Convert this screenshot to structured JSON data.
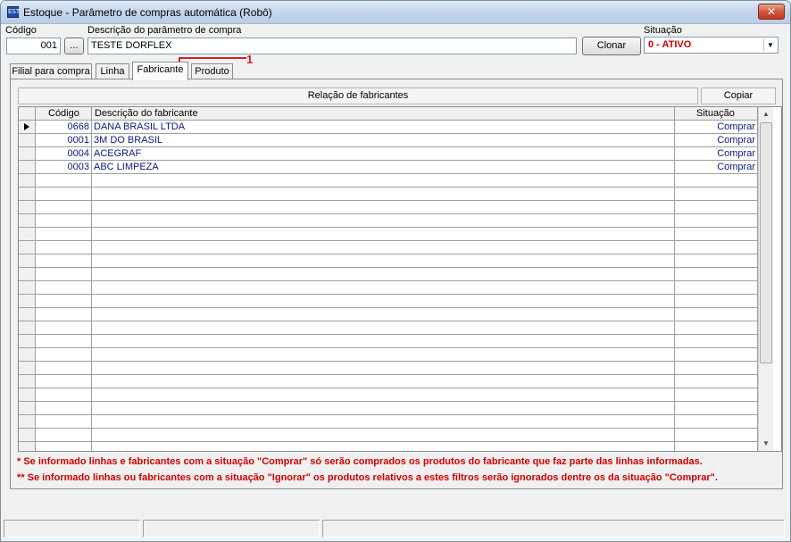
{
  "window": {
    "title": "Estoque - Parâmetro de compras automática (Robô)",
    "icon_text": "EST",
    "close_glyph": "✕"
  },
  "form": {
    "codigo_label": "Código",
    "codigo_value": "001",
    "lookup_button": "...",
    "descricao_label": "Descrição do parâmetro de compra",
    "descricao_value": "TESTE DORFLEX",
    "clonar_button": "Clonar",
    "situacao_label": "Situação",
    "situacao_value": "0 - ATIVO"
  },
  "tabs": [
    {
      "label": "Filial para compra",
      "active": false
    },
    {
      "label": "Linha",
      "active": false
    },
    {
      "label": "Fabricante",
      "active": true
    },
    {
      "label": "Produto",
      "active": false
    }
  ],
  "annotation": {
    "number": "1",
    "color": "#d02020"
  },
  "grid": {
    "title": "Relação de fabricantes",
    "copy_button": "Copiar",
    "columns": [
      "Código",
      "Descrição do fabricante",
      "Situação"
    ],
    "rows": [
      {
        "codigo": "0668",
        "descricao": " DANA BRASIL LTDA",
        "situacao": "Comprar"
      },
      {
        "codigo": "0001",
        "descricao": "3M DO BRASIL",
        "situacao": "Comprar"
      },
      {
        "codigo": "0004",
        "descricao": "ACEGRAF",
        "situacao": "Comprar"
      },
      {
        "codigo": "0003",
        "descricao": "ABC LIMPEZA",
        "situacao": "Comprar"
      }
    ],
    "scroll_up_glyph": "▲",
    "scroll_down_glyph": "▼"
  },
  "notes": [
    "* Se informado linhas e fabricantes com a situação \"Comprar\" só serão comprados os produtos do fabricante que faz parte das linhas informadas.",
    "** Se informado linhas ou fabricantes com a situação \"Ignorar\" os produtos relativos a estes filtros serão ignorados dentre os da situação \"Comprar\"."
  ],
  "colors": {
    "accent_red": "#c00000",
    "grid_text": "#0a1a80"
  }
}
